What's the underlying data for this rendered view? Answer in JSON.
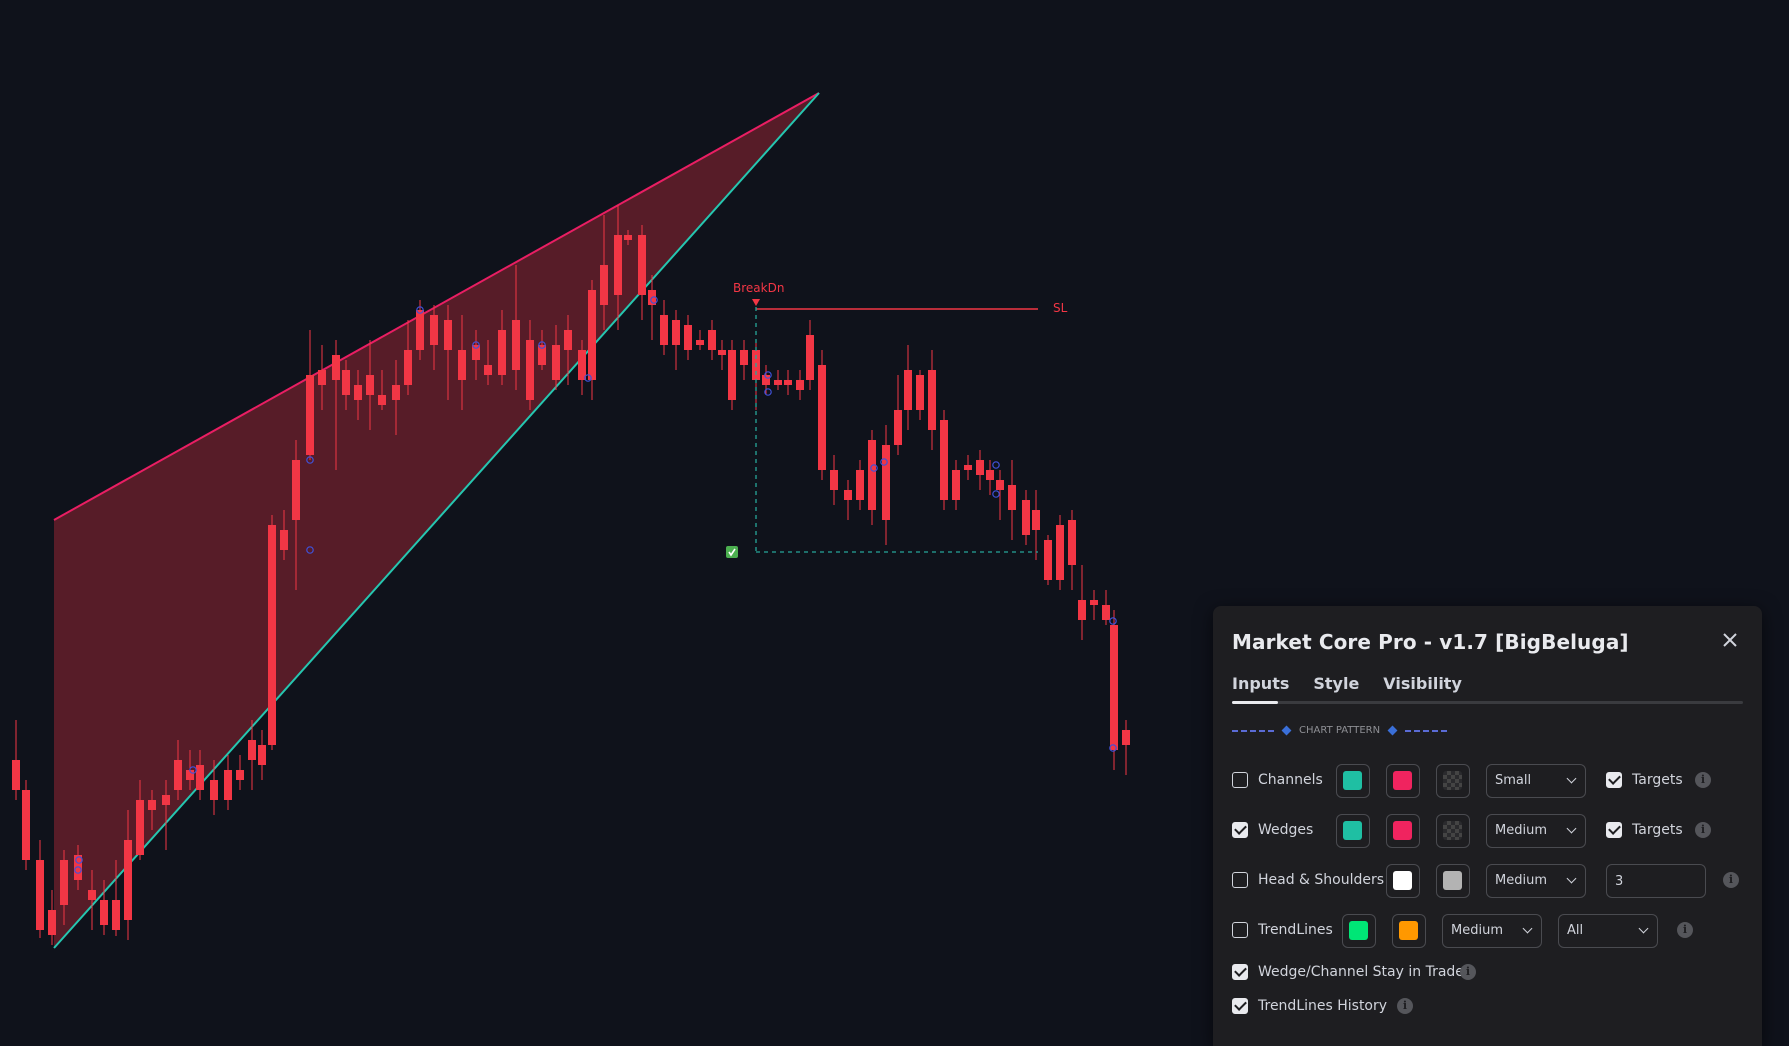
{
  "chart": {
    "labels": {
      "breakdown": "BreakDn",
      "stop_loss": "SL"
    },
    "colors": {
      "background": "#0f121b",
      "bull": "#26a69a",
      "bear": "#f23645",
      "wedge_upper": "#e91e63",
      "wedge_lower": "#26c6b0",
      "wedge_fill": "#6b1f2c",
      "target_line": "#26a69a",
      "pivot_marker": "#3f51d9",
      "arrow": "#eaff00"
    }
  },
  "panel": {
    "title": "Market Core Pro - v1.7 [BigBeluga]",
    "close_icon": "close-icon",
    "tabs": [
      "Inputs",
      "Style",
      "Visibility"
    ],
    "active_tab": "Inputs",
    "section": "CHART PATTERN",
    "rows": {
      "channels": {
        "label": "Channels",
        "checked": false,
        "color1": "#1fbfa3",
        "color2": "#f0245f",
        "size": "Small",
        "targets_label": "Targets",
        "targets_checked": true
      },
      "wedges": {
        "label": "Wedges",
        "checked": true,
        "color1": "#1fbfa3",
        "color2": "#f0245f",
        "size": "Medium",
        "targets_label": "Targets",
        "targets_checked": true
      },
      "head_shoulders": {
        "label": "Head & Shoulders",
        "checked": false,
        "color1": "#ffffff",
        "color2": "#b3b3b3",
        "size": "Medium",
        "value": "3"
      },
      "trendlines": {
        "label": "TrendLines",
        "checked": false,
        "color1": "#00e676",
        "color2": "#ff9800",
        "size": "Medium",
        "mode": "All"
      },
      "stay_in_trade": {
        "label": "Wedge/Channel Stay in Trade",
        "checked": true
      },
      "trendlines_history": {
        "label": "TrendLines History",
        "checked": true
      }
    }
  }
}
